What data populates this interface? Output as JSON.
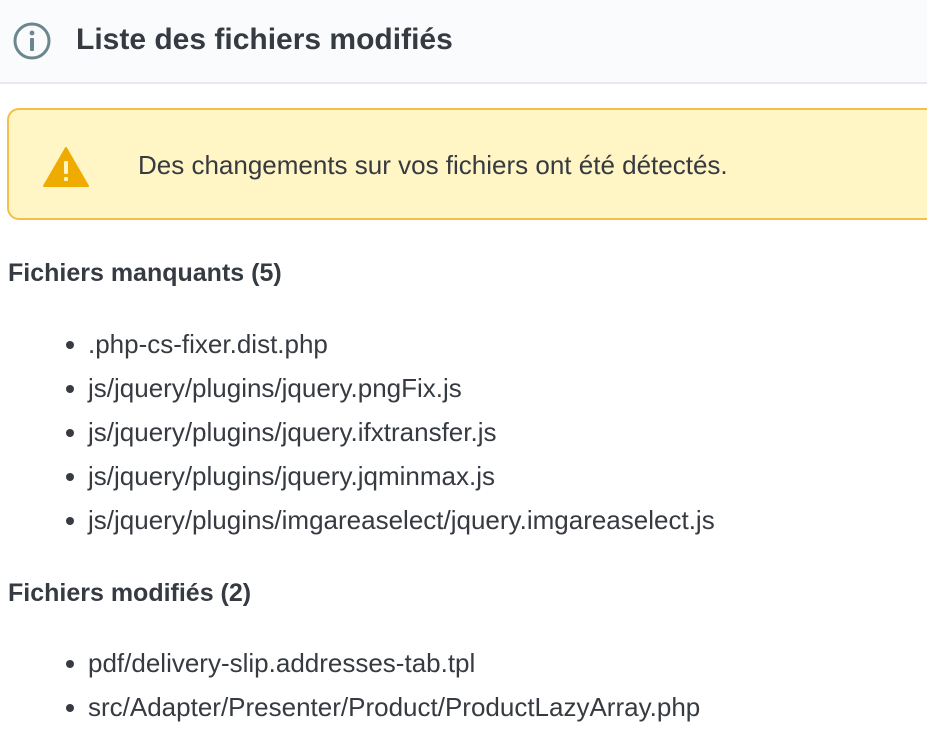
{
  "header": {
    "title": "Liste des fichiers modifiés",
    "icon": "info-circle-icon"
  },
  "alert": {
    "icon": "warning-icon",
    "message": "Des changements sur vos fichiers ont été détectés.",
    "colors": {
      "background": "#fff5c5",
      "border": "#f1c048",
      "icon": "#f0ab00"
    }
  },
  "missing_files": {
    "title": "Fichiers manquants (5)",
    "items": [
      ".php-cs-fixer.dist.php",
      "js/jquery/plugins/jquery.pngFix.js",
      "js/jquery/plugins/jquery.ifxtransfer.js",
      "js/jquery/plugins/jquery.jqminmax.js",
      "js/jquery/plugins/imgareaselect/jquery.imgareaselect.js"
    ]
  },
  "modified_files": {
    "title": "Fichiers modifiés (2)",
    "items": [
      "pdf/delivery-slip.addresses-tab.tpl",
      "src/Adapter/Presenter/Product/ProductLazyArray.php"
    ]
  }
}
